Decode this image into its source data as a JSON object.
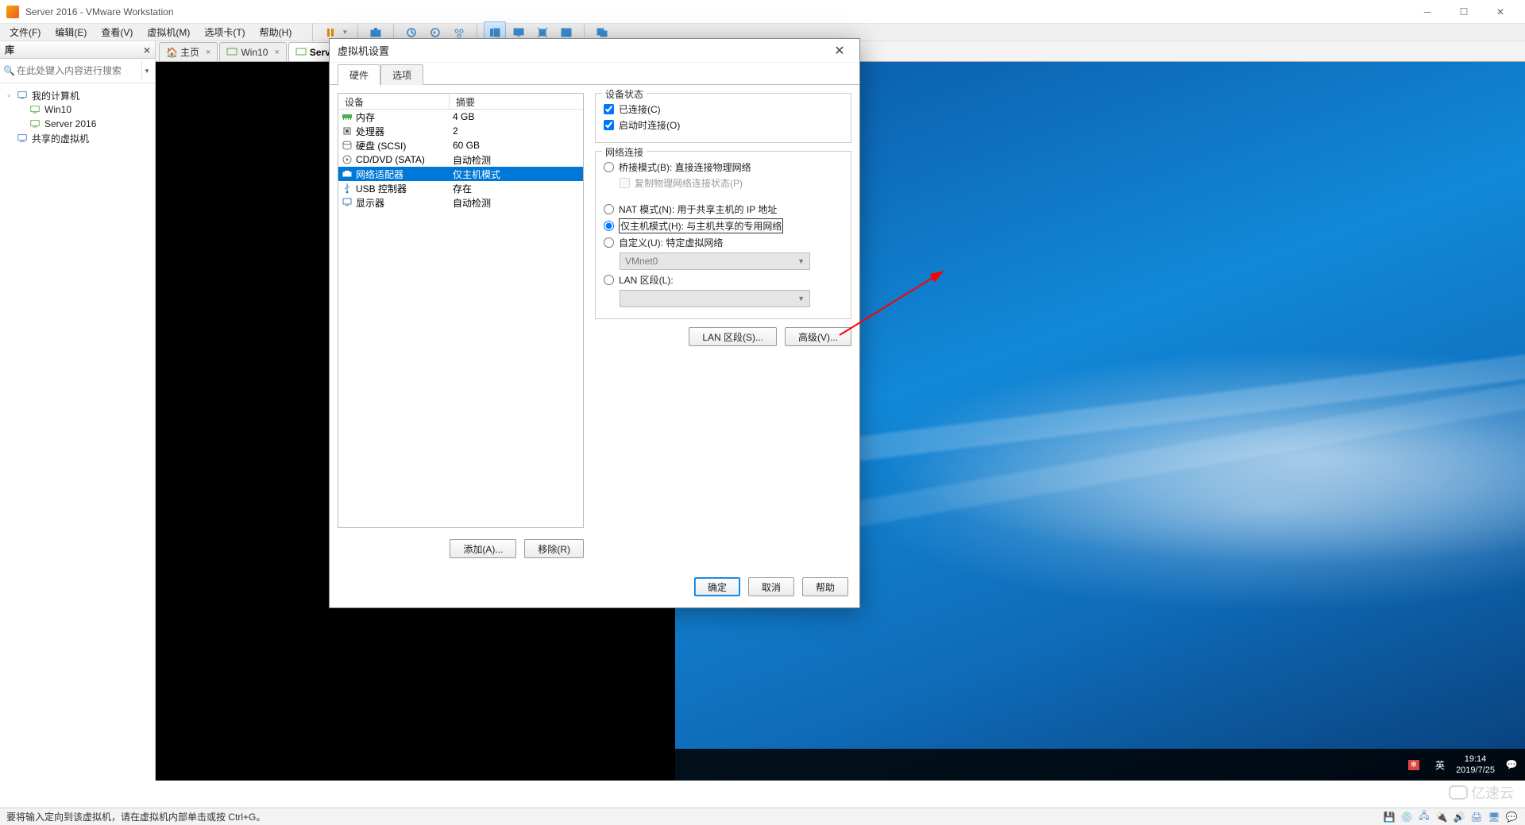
{
  "titlebar": {
    "title": "Server 2016 - VMware Workstation"
  },
  "menu": {
    "file": "文件(F)",
    "edit": "编辑(E)",
    "view": "查看(V)",
    "vm": "虚拟机(M)",
    "tabs": "选项卡(T)",
    "help": "帮助(H)"
  },
  "library": {
    "title": "库",
    "search_placeholder": "在此处键入内容进行搜索",
    "root": "我的计算机",
    "items": [
      "Win10",
      "Server 2016"
    ],
    "shared": "共享的虚拟机"
  },
  "tabs": {
    "home": "主页",
    "win10": "Win10",
    "server": "Server 2016"
  },
  "dialog": {
    "title": "虚拟机设置",
    "tab_hw": "硬件",
    "tab_opt": "选项",
    "col_device": "设备",
    "col_summary": "摘要",
    "devices": [
      {
        "name": "内存",
        "sum": "4 GB",
        "icon": "ram"
      },
      {
        "name": "处理器",
        "sum": "2",
        "icon": "cpu"
      },
      {
        "name": "硬盘 (SCSI)",
        "sum": "60 GB",
        "icon": "hdd"
      },
      {
        "name": "CD/DVD (SATA)",
        "sum": "自动检测",
        "icon": "cd"
      },
      {
        "name": "网络适配器",
        "sum": "仅主机模式",
        "icon": "net"
      },
      {
        "name": "USB 控制器",
        "sum": "存在",
        "icon": "usb"
      },
      {
        "name": "显示器",
        "sum": "自动检测",
        "icon": "disp"
      }
    ],
    "add": "添加(A)...",
    "remove": "移除(R)",
    "state_group": "设备状态",
    "connected": "已连接(C)",
    "connect_at_power": "启动时连接(O)",
    "net_group": "网络连接",
    "bridged": "桥接模式(B): 直接连接物理网络",
    "replicate": "复制物理网络连接状态(P)",
    "nat": "NAT 模式(N): 用于共享主机的 IP 地址",
    "hostonly": "仅主机模式(H): 与主机共享的专用网络",
    "custom": "自定义(U): 特定虚拟网络",
    "custom_net": "VMnet0",
    "lan": "LAN 区段(L):",
    "lan_btn": "LAN 区段(S)...",
    "adv_btn": "高级(V)...",
    "ok": "确定",
    "cancel": "取消",
    "help": "帮助"
  },
  "guest": {
    "ime_ch": "中",
    "ime_lang": "英",
    "time": "19:14",
    "date": "2019/7/25"
  },
  "statusbar": {
    "msg": "要将输入定向到该虚拟机，请在虚拟机内部单击或按 Ctrl+G。"
  },
  "watermark": "亿速云"
}
